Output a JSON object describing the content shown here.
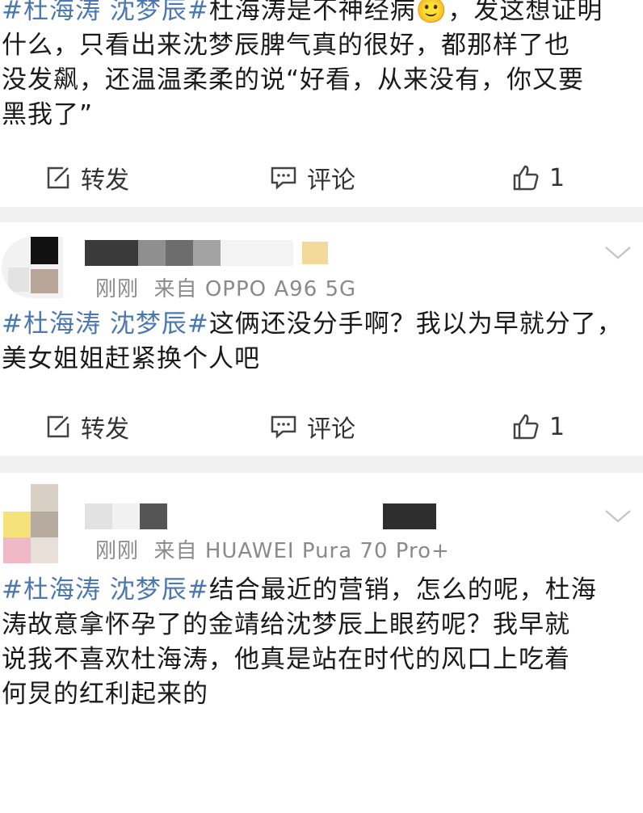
{
  "posts": [
    {
      "body": [
        [
          {
            "t": "#杜海涛 沈梦辰#",
            "tag": true
          },
          {
            "t": "杜海涛是不神经病🙂，发这想证明"
          }
        ],
        [
          {
            "t": "什么，只看出来沈梦辰脾气真的很好，都那样了也"
          }
        ],
        [
          {
            "t": "没发飙，还温温柔柔的说“好看，从来没有，你又要"
          }
        ],
        [
          {
            "t": "黑我了”"
          }
        ]
      ],
      "share_label": "转发",
      "comment_label": "评论",
      "like_count": "1"
    },
    {
      "meta_time": "刚刚",
      "meta_from": "来自",
      "meta_device": "OPPO A96 5G",
      "body": [
        [
          {
            "t": "#杜海涛 沈梦辰#",
            "tag": true
          },
          {
            "t": "这俩还没分手啊？我以为早就分了，"
          }
        ],
        [
          {
            "t": "美女姐姐赶紧换个人吧"
          }
        ]
      ],
      "share_label": "转发",
      "comment_label": "评论",
      "like_count": "1"
    },
    {
      "meta_time": "刚刚",
      "meta_from": "来自",
      "meta_device": "HUAWEI Pura 70 Pro+",
      "body": [
        [
          {
            "t": "#杜海涛 沈梦辰#",
            "tag": true
          },
          {
            "t": "结合最近的营销，怎么的呢，杜海"
          }
        ],
        [
          {
            "t": "涛故意拿怀孕了的金靖给沈梦辰上眼药呢？我早就"
          }
        ],
        [
          {
            "t": "说我不喜欢杜海涛，他真是站在时代的风口上吃着"
          }
        ],
        [
          {
            "t": "何炅的红利起来的"
          }
        ]
      ]
    }
  ],
  "colors": {
    "tag": "#4b78b0",
    "meta": "#8a8a8a",
    "separator": "#f1f1f1"
  },
  "icons": {
    "share": "share-icon",
    "comment": "comment-icon",
    "like": "thumbs-up-icon",
    "expand": "chevron-down-icon"
  }
}
